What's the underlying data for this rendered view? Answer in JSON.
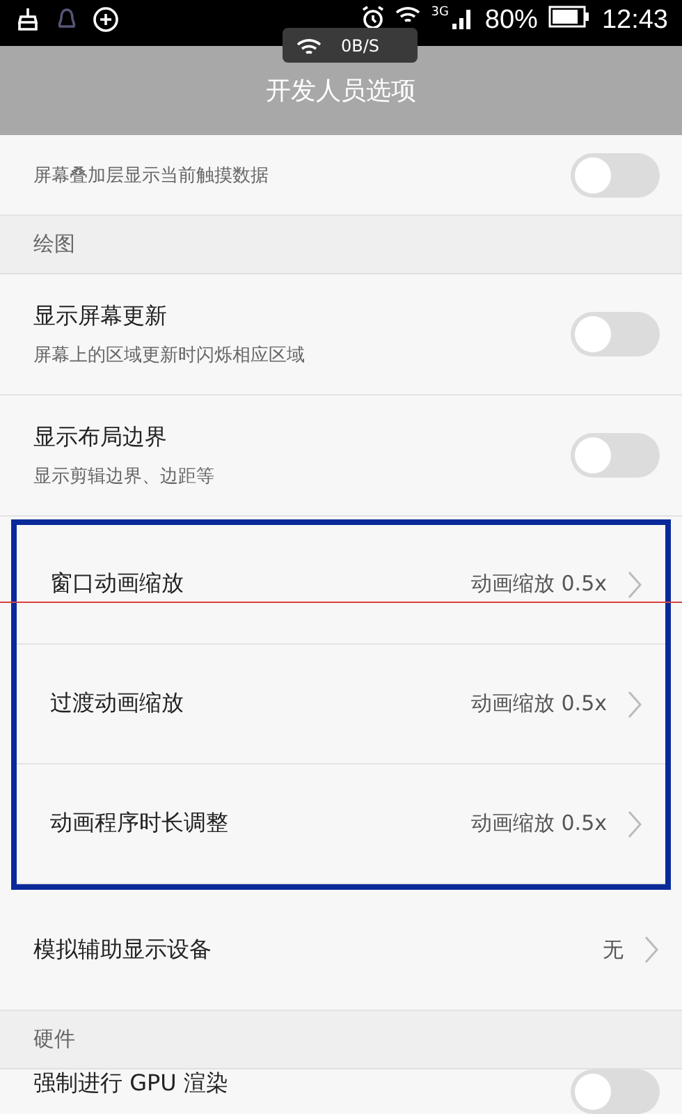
{
  "status_bar": {
    "network_type": "3G",
    "battery": "80%",
    "time": "12:43"
  },
  "speed_toast": {
    "text": "0B/S"
  },
  "header": {
    "title": "开发人员选项"
  },
  "sections": [
    {
      "kind": "items",
      "items": [
        {
          "kind": "toggle",
          "subtitle": "屏幕叠加层显示当前触摸数据",
          "on": false
        }
      ]
    },
    {
      "kind": "header",
      "label": "绘图"
    },
    {
      "kind": "items",
      "items": [
        {
          "kind": "toggle",
          "title": "显示屏幕更新",
          "subtitle": "屏幕上的区域更新时闪烁相应区域",
          "on": false
        },
        {
          "kind": "toggle",
          "title": "显示布局边界",
          "subtitle": "显示剪辑边界、边距等",
          "on": false
        }
      ]
    },
    {
      "kind": "highlighted_items",
      "items": [
        {
          "kind": "link",
          "title": "窗口动画缩放",
          "value": "动画缩放 0.5x"
        },
        {
          "kind": "link",
          "title": "过渡动画缩放",
          "value": "动画缩放 0.5x"
        },
        {
          "kind": "link",
          "title": "动画程序时长调整",
          "value": "动画缩放 0.5x"
        }
      ]
    },
    {
      "kind": "items",
      "items": [
        {
          "kind": "link",
          "title": "模拟辅助显示设备",
          "value": "无"
        }
      ]
    },
    {
      "kind": "header",
      "label": "硬件"
    },
    {
      "kind": "items",
      "items": [
        {
          "kind": "toggle",
          "title": "强制进行 GPU 渲染",
          "on": false
        }
      ]
    }
  ]
}
